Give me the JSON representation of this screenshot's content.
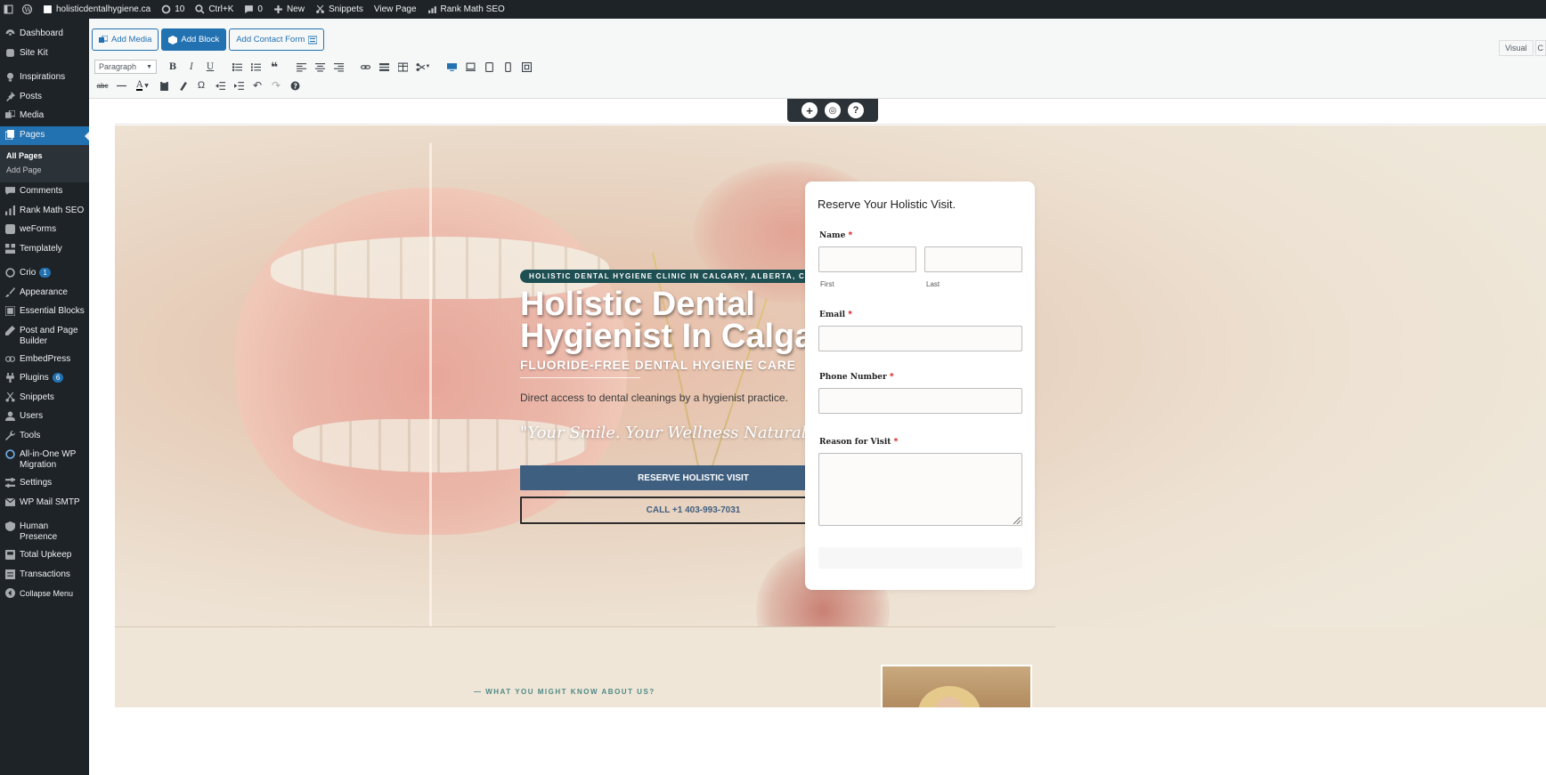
{
  "adminbar": {
    "site": "holisticdentalhygiene.ca",
    "updates": "10",
    "search": "Ctrl+K",
    "comments": "0",
    "new": "New",
    "snippets": "Snippets",
    "view_page": "View Page",
    "rank_math": "Rank Math SEO"
  },
  "sidebar": {
    "items": [
      {
        "label": "Dashboard",
        "icon": "dashboard-icon"
      },
      {
        "label": "Site Kit",
        "icon": "sitekit-icon"
      },
      {
        "label": "Inspirations",
        "icon": "lightbulb-icon"
      },
      {
        "label": "Posts",
        "icon": "pin-icon"
      },
      {
        "label": "Media",
        "icon": "media-icon"
      },
      {
        "label": "Pages",
        "icon": "pages-icon"
      },
      {
        "label": "Comments",
        "icon": "comment-icon"
      },
      {
        "label": "Rank Math SEO",
        "icon": "chart-icon"
      },
      {
        "label": "weForms",
        "icon": "forms-icon"
      },
      {
        "label": "Templately",
        "icon": "templately-icon"
      },
      {
        "label": "Crio",
        "icon": "crio-icon",
        "badge": "1"
      },
      {
        "label": "Appearance",
        "icon": "brush-icon"
      },
      {
        "label": "Essential Blocks",
        "icon": "blocks-icon"
      },
      {
        "label": "Post and Page Builder",
        "icon": "pencil-icon"
      },
      {
        "label": "EmbedPress",
        "icon": "embed-icon"
      },
      {
        "label": "Plugins",
        "icon": "plug-icon",
        "badge": "6"
      },
      {
        "label": "Snippets",
        "icon": "scissors-icon"
      },
      {
        "label": "Users",
        "icon": "user-icon"
      },
      {
        "label": "Tools",
        "icon": "wrench-icon"
      },
      {
        "label": "All-in-One WP Migration",
        "icon": "migration-icon"
      },
      {
        "label": "Settings",
        "icon": "settings-icon"
      },
      {
        "label": "WP Mail SMTP",
        "icon": "mail-icon"
      },
      {
        "label": "Human Presence",
        "icon": "shield-icon"
      },
      {
        "label": "Total Upkeep",
        "icon": "backup-icon"
      },
      {
        "label": "Transactions",
        "icon": "transactions-icon"
      },
      {
        "label": "Collapse Menu",
        "icon": "collapse-icon"
      }
    ],
    "pages_sub": {
      "all": "All Pages",
      "add": "Add Page"
    }
  },
  "editor": {
    "add_media": "Add Media",
    "add_block": "Add Block",
    "add_contact_form": "Add Contact Form",
    "format": "Paragraph",
    "tab_visual": "Visual",
    "tab_code": "C"
  },
  "hero": {
    "eyebrow": "HOLISTIC DENTAL HYGIENE CLINIC IN CALGARY, ALBERTA, CA",
    "title": "Holistic Dental Hygienist In Calgary",
    "subtitle": "FLUORIDE-FREE DENTAL HYGIENE CARE",
    "description": "Direct access to dental cleanings by a hygienist practice.",
    "quote": "\"Your Smile. Your Wellness Naturally.\"",
    "cta_primary": "RESERVE HOLISTIC VISIT",
    "cta_secondary": "CALL +1 403-993-7031"
  },
  "form": {
    "title": "Reserve Your Holistic Visit.",
    "name_label": "Name",
    "first_hint": "First",
    "last_hint": "Last",
    "email_label": "Email",
    "phone_label": "Phone Number",
    "reason_label": "Reason for Visit",
    "required_mark": "*"
  },
  "section2": {
    "eyebrow": "— WHAT YOU MIGHT KNOW ABOUT US?"
  },
  "colors": {
    "admin_dark": "#1d2327",
    "wp_blue": "#2271b1",
    "pill_teal": "#1e4f53",
    "cta_blue": "#3f5f80"
  }
}
